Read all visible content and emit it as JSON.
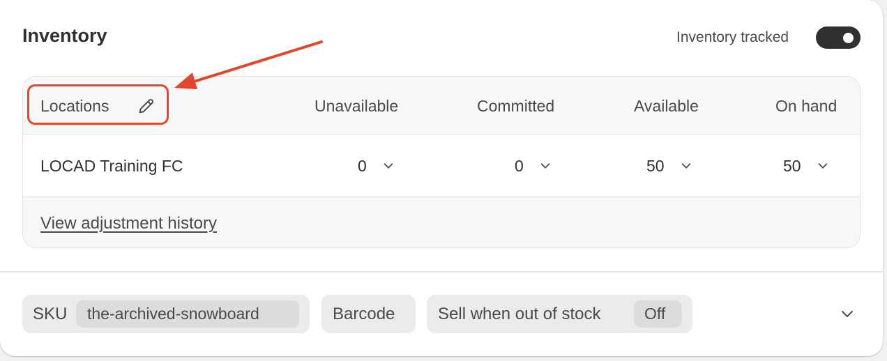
{
  "card": {
    "title": "Inventory",
    "tracked_label": "Inventory tracked",
    "tracked_on": true
  },
  "table": {
    "headers": {
      "locations": "Locations",
      "unavailable": "Unavailable",
      "committed": "Committed",
      "available": "Available",
      "on_hand": "On hand"
    },
    "rows": [
      {
        "location": "LOCAD Training FC",
        "unavailable": "0",
        "committed": "0",
        "available": "50",
        "on_hand": "50"
      }
    ],
    "history_link": "View adjustment history"
  },
  "attributes": {
    "sku_label": "SKU",
    "sku_value": "the-archived-snowboard",
    "barcode_label": "Barcode",
    "sell_oos_label": "Sell when out of stock",
    "sell_oos_value": "Off"
  },
  "annotation": {
    "color": "#e0472c"
  },
  "icons": {
    "edit": "pencil-icon",
    "row_chevrons": "chevron-down-icon",
    "expand": "chevron-down-icon"
  }
}
